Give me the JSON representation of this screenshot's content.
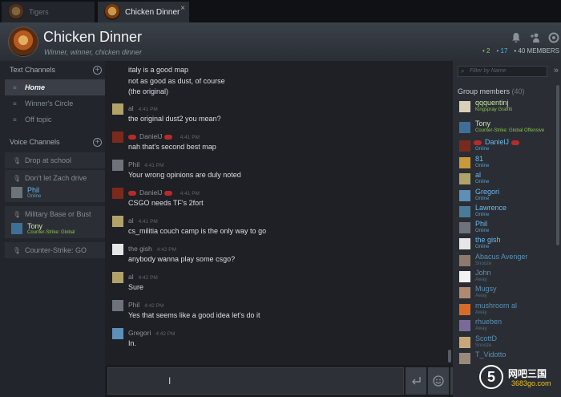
{
  "tabs": [
    {
      "label": "Tigers"
    },
    {
      "label": "Chicken Dinner",
      "close": "×"
    }
  ],
  "header": {
    "title": "Chicken Dinner",
    "tagline": "Winner, winner, chicken dinner",
    "stats": {
      "online": "• 2",
      "ingame": "• 17",
      "members": "• 40 MEMBERS"
    }
  },
  "sidebar": {
    "text_channels_title": "Text Channels",
    "text_channels": [
      {
        "label": "Home"
      },
      {
        "label": "Winner's Circle"
      },
      {
        "label": "Off topic"
      }
    ],
    "voice_channels_title": "Voice Channels",
    "voice_channels": [
      {
        "label": "Drop at school"
      },
      {
        "label": "Don't let Zach drive",
        "user": {
          "name": "Phil",
          "status": "Online"
        }
      },
      {
        "label": "Military Base or Bust",
        "user": {
          "name": "Tony",
          "status": "Counter-Strike: Global"
        }
      },
      {
        "label": "Counter-Strike: GO"
      }
    ]
  },
  "messages": [
    {
      "lines": [
        "italy is a good map",
        "not as good as dust, of course",
        "(the original)"
      ]
    },
    {
      "author": "al",
      "time": "4:41 PM",
      "text": "the original dust2 you mean?"
    },
    {
      "author": "DanielJ",
      "time": "4:41 PM",
      "text": "nah that's second best map"
    },
    {
      "author": "Phil",
      "time": "4:41 PM",
      "text": "Your wrong opinions are duly noted"
    },
    {
      "author": "DanielJ",
      "time": "4:41 PM",
      "text": "CSGO needs TF's 2fort"
    },
    {
      "author": "al",
      "time": "4:41 PM",
      "text": "cs_militia couch camp is the only way to go"
    },
    {
      "author": "the gish",
      "time": "4:42 PM",
      "text": "anybody wanna play some csgo?"
    },
    {
      "author": "al",
      "time": "4:42 PM",
      "text": "Sure"
    },
    {
      "author": "Phil",
      "time": "4:42 PM",
      "text": "Yes that seems like a good idea let's do it"
    },
    {
      "author": "Gregori",
      "time": "4:42 PM",
      "text": "In."
    }
  ],
  "members_panel": {
    "filter_placeholder": "Filter by Name",
    "title": "Group members",
    "count": "(40)",
    "members": [
      {
        "name": "qqquentinj",
        "status": "Kingspray Graffiti",
        "color": "#9cd25a"
      },
      {
        "name": "Tony",
        "status": "Counter-Strike: Global Offensive",
        "color": "#9cd25a"
      },
      {
        "name": "DanielJ",
        "status": "Online",
        "color": "#6cb8ec"
      },
      {
        "name": "81",
        "status": "Online",
        "color": "#6cb8ec"
      },
      {
        "name": "al",
        "status": "Online",
        "color": "#6cb8ec"
      },
      {
        "name": "Gregori",
        "status": "Online",
        "color": "#6cb8ec"
      },
      {
        "name": "Lawrence",
        "status": "Online",
        "color": "#6cb8ec"
      },
      {
        "name": "Phil",
        "status": "Online",
        "color": "#6cb8ec"
      },
      {
        "name": "the gish",
        "status": "Online",
        "color": "#6cb8ec"
      },
      {
        "name": "Abacus Avenger",
        "status": "Snooze",
        "color": "#5b8fb3"
      },
      {
        "name": "John",
        "status": "Away",
        "color": "#5b8fb3"
      },
      {
        "name": "Mugsy",
        "status": "Away",
        "color": "#5b8fb3"
      },
      {
        "name": "mushroom al",
        "status": "Away",
        "color": "#5b8fb3"
      },
      {
        "name": "rhueben",
        "status": "Away",
        "color": "#5b8fb3"
      },
      {
        "name": "ScottD",
        "status": "Snooze",
        "color": "#5b8fb3"
      },
      {
        "name": "T_Vidotto",
        "status": "",
        "color": "#5b8fb3"
      }
    ]
  },
  "watermark": {
    "logo": "5",
    "text": "网吧三国",
    "sub": "3683go.com"
  }
}
